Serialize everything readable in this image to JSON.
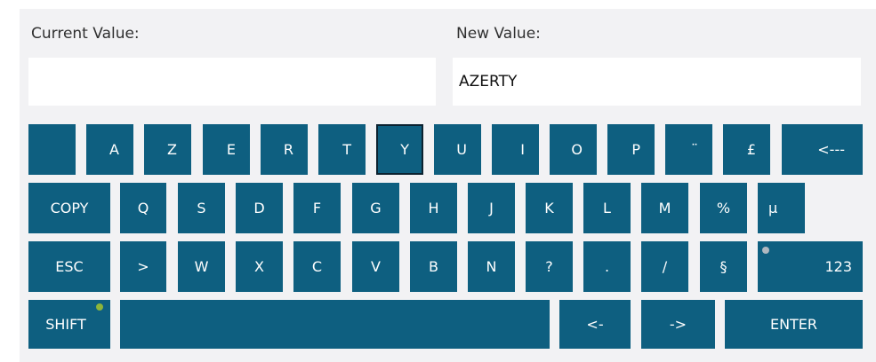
{
  "labels": {
    "current": "Current Value:",
    "new": "New Value:"
  },
  "fields": {
    "current_value": "",
    "new_value": "AZERTY"
  },
  "keys": {
    "row1": [
      "",
      "A",
      "Z",
      "E",
      "R",
      "T",
      "Y",
      "U",
      "I",
      "O",
      "P",
      "¨",
      "£",
      "<---"
    ],
    "row2": [
      "COPY",
      "Q",
      "S",
      "D",
      "F",
      "G",
      "H",
      "J",
      "K",
      "L",
      "M",
      "%",
      "µ"
    ],
    "row3": [
      "ESC",
      ">",
      "W",
      "X",
      "C",
      "V",
      "B",
      "N",
      "?",
      ".",
      "/",
      "§",
      "123"
    ],
    "row4": [
      "SHIFT",
      "",
      "<-",
      "->",
      "ENTER"
    ]
  },
  "colors": {
    "key": "#0e5f80",
    "panel": "#f2f2f4",
    "shift_indicator": "#8db53a",
    "num_indicator": "#b0b8c0"
  }
}
